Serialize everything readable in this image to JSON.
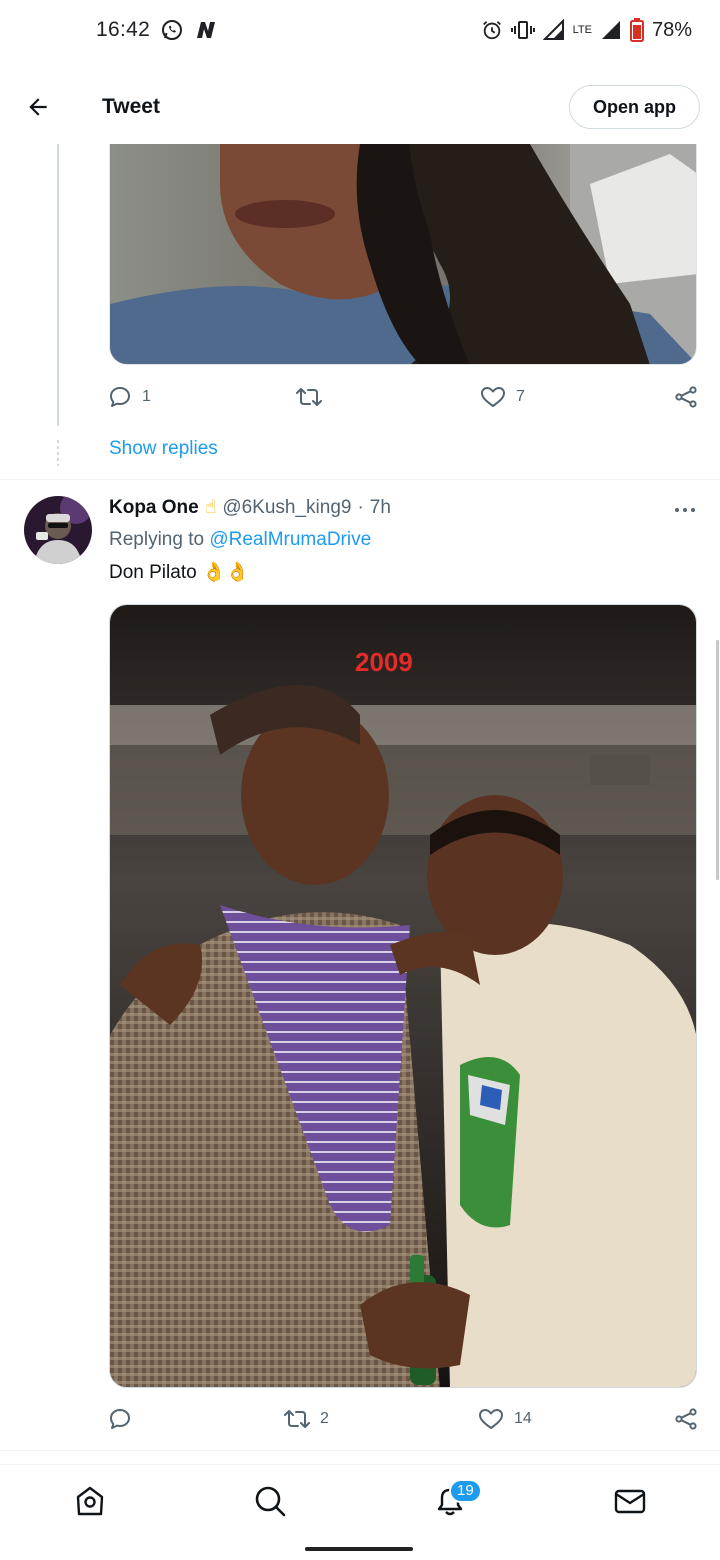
{
  "status_bar": {
    "time": "16:42",
    "network": "LTE",
    "battery": "78%",
    "icons": [
      "whatsapp-icon",
      "n-notification-icon",
      "alarm-icon",
      "vibrate-icon",
      "signal-icon",
      "battery-icon"
    ]
  },
  "header": {
    "title": "Tweet",
    "open_app_label": "Open app"
  },
  "tweet1": {
    "reply_count": "1",
    "retweet_count": "",
    "like_count": "7",
    "show_replies_label": "Show replies"
  },
  "tweet2": {
    "author_name": "Kopa One",
    "author_emoji": "☝",
    "handle": "@6Kush_king9",
    "separator": "·",
    "time": "7h",
    "replying_prefix": "Replying to",
    "replying_to": "@RealMrumaDrive",
    "text": "Don Pilato",
    "text_emoji": "👌👌",
    "photo_caption": "2009",
    "reply_count": "",
    "retweet_count": "2",
    "like_count": "14"
  },
  "bottom_nav": {
    "items": [
      "home-icon",
      "search-icon",
      "notifications-icon",
      "messages-icon"
    ],
    "notification_badge": "19"
  },
  "colors": {
    "accent": "#1d9bf0",
    "secondary_text": "#536471",
    "primary_text": "#0f1419",
    "divider": "#eff3f4"
  }
}
